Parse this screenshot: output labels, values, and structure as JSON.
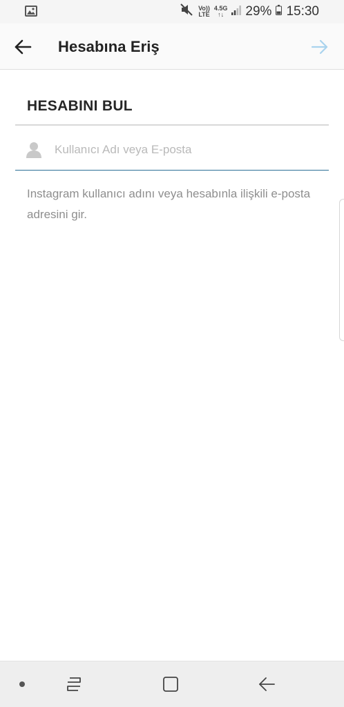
{
  "status_bar": {
    "volte": "Vo))",
    "lte": "LTE",
    "net": "4.5G",
    "net_arrows": "↑↓",
    "battery_percent": "29%",
    "time": "15:30",
    "icons": [
      "gallery-notification-icon",
      "mute-icon",
      "signal-icon",
      "battery-icon"
    ]
  },
  "app_bar": {
    "title": "Hesabına Eriş",
    "icons": [
      "back-arrow-icon",
      "next-arrow-icon"
    ],
    "next_color": "#a9d3ee"
  },
  "form": {
    "section_title": "HESABINI BUL",
    "input_value": "",
    "input_placeholder": "Kullanıcı Adı veya E-posta",
    "help_text": "Instagram kullanıcı adını veya hesabınla ilişkili e-posta adresini gir.",
    "accent_color": "#2a6e96"
  },
  "nav_bar": {
    "icons": [
      "nav-dot-icon",
      "recents-icon",
      "home-icon",
      "back-icon"
    ]
  }
}
